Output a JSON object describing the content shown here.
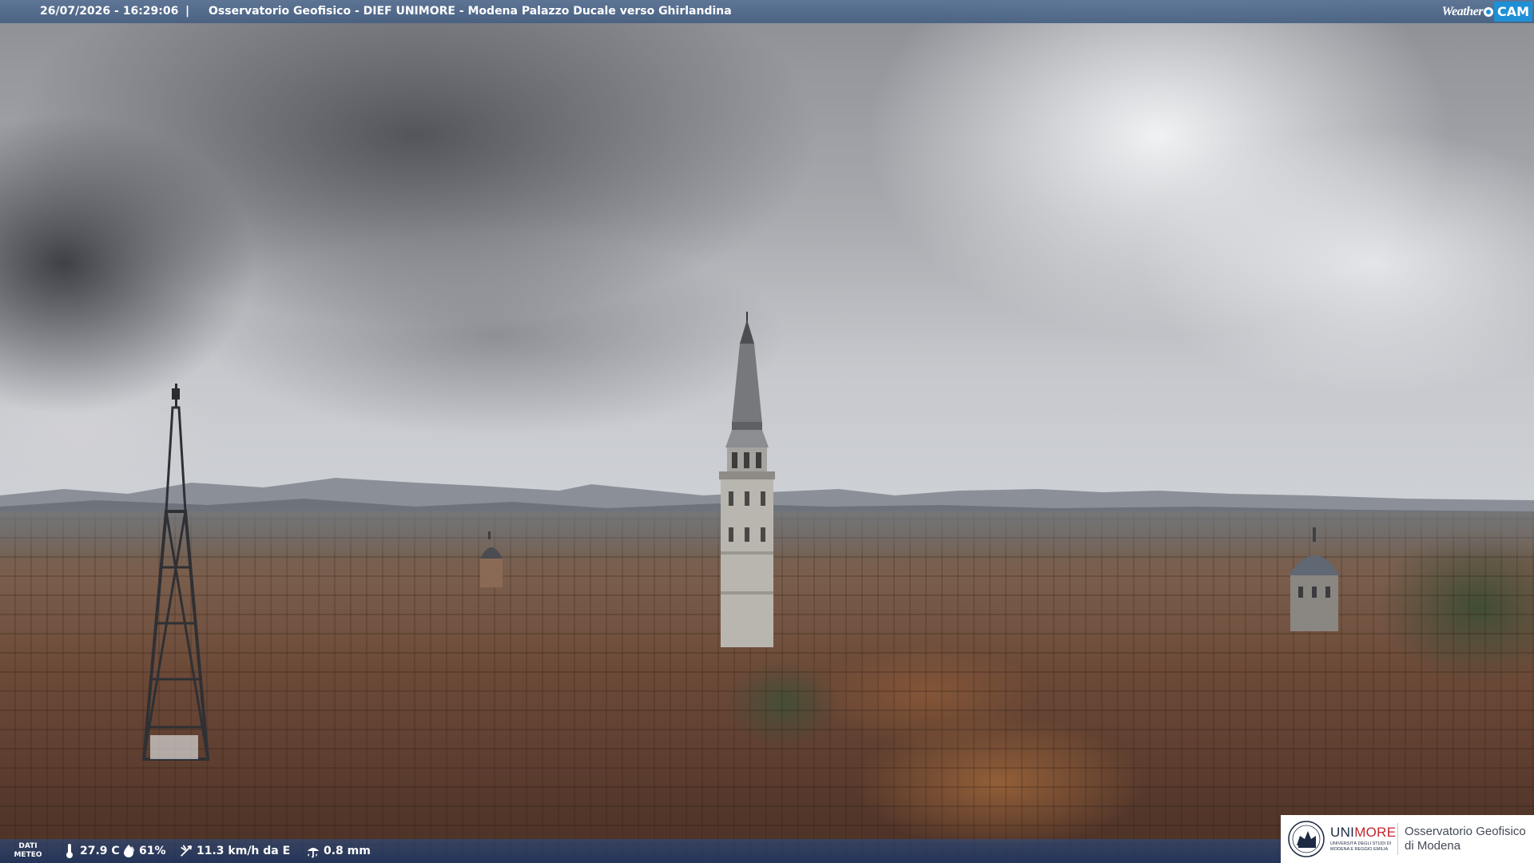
{
  "overlay": {
    "timestamp": "26/07/2026 - 16:29:06",
    "separator": "|",
    "caption": "Osservatorio Geofisico - DIEF UNIMORE - Modena Palazzo Ducale verso Ghirlandina"
  },
  "logo": {
    "weather": "Weather",
    "cam": "CAM",
    "brand_blue": "#1f8fd6"
  },
  "meteo": {
    "label_line1": "DATI",
    "label_line2": "METEO",
    "temperature": "27.9 C",
    "humidity": "61%",
    "wind": "11.3 km/h da E",
    "rain": "0.8 mm",
    "icons": [
      "thermometer-icon",
      "humidity-drop-icon",
      "wind-icon",
      "rain-icon"
    ]
  },
  "unimore": {
    "name_a": "UNI",
    "name_b": "MORE",
    "subtitle_line1": "UNIVERSITÀ DEGLI STUDI DI",
    "subtitle_line2": "MODENA E REGGIO EMILIA",
    "observatory_line1": "Osservatorio Geofisico",
    "observatory_line2": "di Modena",
    "brand_red": "#c0272d",
    "brand_navy": "#1d2a44"
  }
}
